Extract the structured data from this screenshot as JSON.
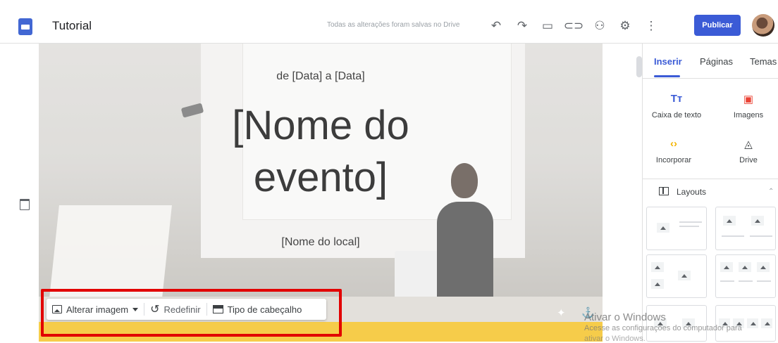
{
  "header": {
    "title": "Tutorial",
    "save_status": "Todas as alterações foram salvas no Drive",
    "publish_label": "Publicar"
  },
  "hero": {
    "date": "de [Data] a [Data]",
    "event_name_line1": "[Nome do",
    "event_name_line2": "evento]",
    "venue": "[Nome do local]"
  },
  "image_toolbar": {
    "change_image": "Alterar imagem",
    "reset": "Redefinir",
    "header_type": "Tipo de cabeçalho"
  },
  "panel": {
    "tabs": [
      "Inserir",
      "Páginas",
      "Temas"
    ],
    "insert_items": [
      {
        "label": "Caixa de texto",
        "glyph": "Tт",
        "icon": "text-box-icon",
        "color": "#3b5bd6"
      },
      {
        "label": "Imagens",
        "glyph": "▣",
        "icon": "image-icon",
        "color": "#ea4335"
      },
      {
        "label": "Incorporar",
        "glyph": "‹›",
        "icon": "embed-icon",
        "color": "#f4b400"
      },
      {
        "label": "Drive",
        "glyph": "◬",
        "icon": "drive-icon",
        "color": "#3c4043"
      }
    ],
    "layouts_label": "Layouts"
  },
  "watermark": {
    "line1": "Ativar o Windows",
    "line2": "Acesse as configurações do computador para",
    "line3": "ativar o Windows."
  },
  "colors": {
    "accent": "#3b5bd6",
    "highlight_box": "#e20000",
    "banner": "#f6cc4a"
  }
}
